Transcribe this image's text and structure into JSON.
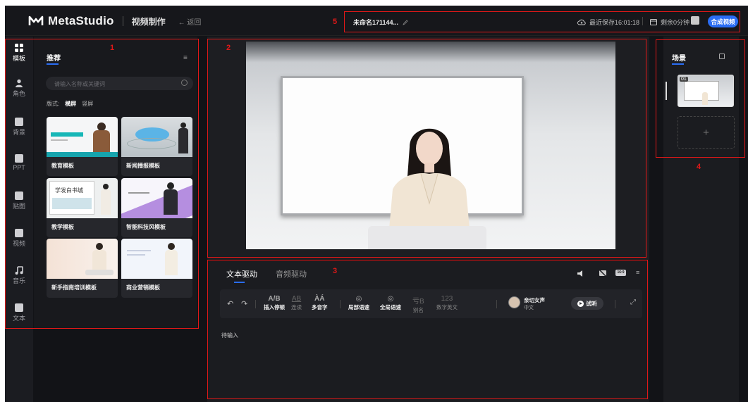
{
  "header": {
    "logo_text": "MetaStudio",
    "module_title": "视频制作",
    "back_label": "← 返回",
    "project_name": "未命名171144...",
    "save_status": "最近保存16:01:18",
    "remaining_time": "剩余0分钟",
    "generate_button": "合成视频",
    "accent_color": "#2a6df4"
  },
  "nav": {
    "items": [
      {
        "label": "模板",
        "icon": "template-icon"
      },
      {
        "label": "角色",
        "icon": "person-icon"
      },
      {
        "label": "背景",
        "icon": "background-icon"
      },
      {
        "label": "PPT",
        "icon": "ppt-icon"
      },
      {
        "label": "贴图",
        "icon": "sticker-icon"
      },
      {
        "label": "视频",
        "icon": "video-icon"
      },
      {
        "label": "音乐",
        "icon": "music-icon"
      },
      {
        "label": "文本",
        "icon": "text-icon"
      }
    ]
  },
  "library": {
    "tab": "推荐",
    "search_placeholder": "请输入名称或关键词",
    "format_label": "版式:",
    "format_options": [
      "横屏",
      "竖屏"
    ],
    "cards": [
      {
        "label": "教育模板"
      },
      {
        "label": "新闻播报模板"
      },
      {
        "label": "教学模板"
      },
      {
        "label": "智能科技风模板"
      },
      {
        "label": "新手指南培训模板"
      },
      {
        "label": "商业营销模板"
      }
    ],
    "thumb_text": "学发白书城"
  },
  "editor": {
    "tabs": [
      "文本驱动",
      "音频驱动"
    ],
    "tools": {
      "insert_pause": {
        "glyph": "A/B",
        "label": "插入停顿"
      },
      "liaison": {
        "glyph": "AB",
        "label": "连读"
      },
      "polyphone": {
        "glyph": "ÀÁ",
        "label": "多音字"
      },
      "local_speed": {
        "label": "局部语速"
      },
      "global_speed": {
        "label": "全局语速"
      },
      "alias": {
        "glyph": "亏B",
        "label": "别名"
      },
      "number_english": {
        "glyph": "123",
        "label": "数字英文"
      }
    },
    "voice": {
      "name": "亲切女声",
      "language": "中文"
    },
    "try_listen": "试听",
    "ratio_badge": "16:9",
    "content_placeholder": "待输入"
  },
  "scene": {
    "tab": "场景",
    "scene_number": "01",
    "add_label": "+"
  },
  "annotations": [
    "1",
    "2",
    "3",
    "4",
    "5"
  ]
}
